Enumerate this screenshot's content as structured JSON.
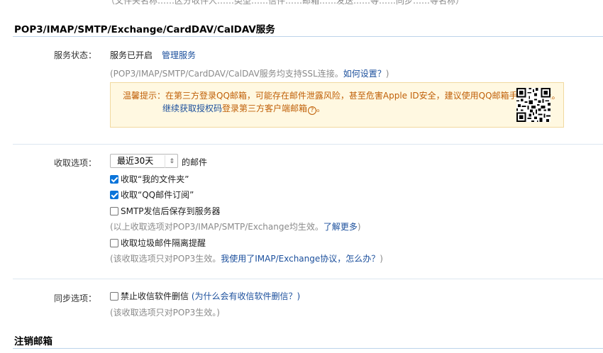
{
  "top_cut_text": "（文件夹名称……区分收件人……类型……信件……邮箱……发送……等……同步……等名称）",
  "pop3_section": {
    "title": "POP3/IMAP/SMTP/Exchange/CardDAV/CalDAV服务",
    "status_label": "服务状态：",
    "status_value": "服务已开启",
    "manage_link": "管理服务",
    "ssl_note": "(POP3/IMAP/SMTP/CardDAV/CalDAV服务均支持SSL连接。",
    "ssl_link": "如何设置？",
    "ssl_note_close": ")",
    "tip_line1": "温馨提示：在第三方登录QQ邮箱，可能存在邮件泄露风险，甚至危害Apple ID安全，建议使用QQ邮箱手机版登录。",
    "tip_link": "继续获取授权码",
    "tip_line2_rest": "登录第三方客户端邮箱",
    "tip_qmark": "?",
    "tip_end": "。"
  },
  "receive": {
    "label": "收取选项：",
    "range_selected": "最近30天",
    "range_suffix": "的邮件",
    "opt_my_folders": "收取“我的文件夹”",
    "opt_my_folders_checked": true,
    "opt_subscription": "收取“QQ邮件订阅”",
    "opt_subscription_checked": true,
    "opt_smtp_save": "SMTP发信后保存到服务器",
    "opt_smtp_save_checked": false,
    "note_above": "(以上收取选项对POP3/IMAP/SMTP/Exchange均生效。",
    "learn_more": "了解更多",
    "note_above_close": ")",
    "opt_spam": "收取垃圾邮件隔离提醒",
    "opt_spam_checked": false,
    "note_pop3": "(该收取选项只对POP3生效。",
    "imap_link": "我使用了IMAP/Exchange协议，怎么办？",
    "note_pop3_close": ")"
  },
  "sync": {
    "label": "同步选项：",
    "opt_no_delete": "禁止收信软件删信",
    "opt_no_delete_checked": false,
    "why_link": "(为什么会有收信软件删信？)",
    "note": "(该收取选项只对POP3生效。)"
  },
  "cancel_section": {
    "title": "注销邮箱"
  },
  "colors": {
    "link": "#1b4f9c",
    "tip_bg": "#fff8e1",
    "tip_text": "#c06008",
    "checkbox_blue": "#0a74da"
  }
}
